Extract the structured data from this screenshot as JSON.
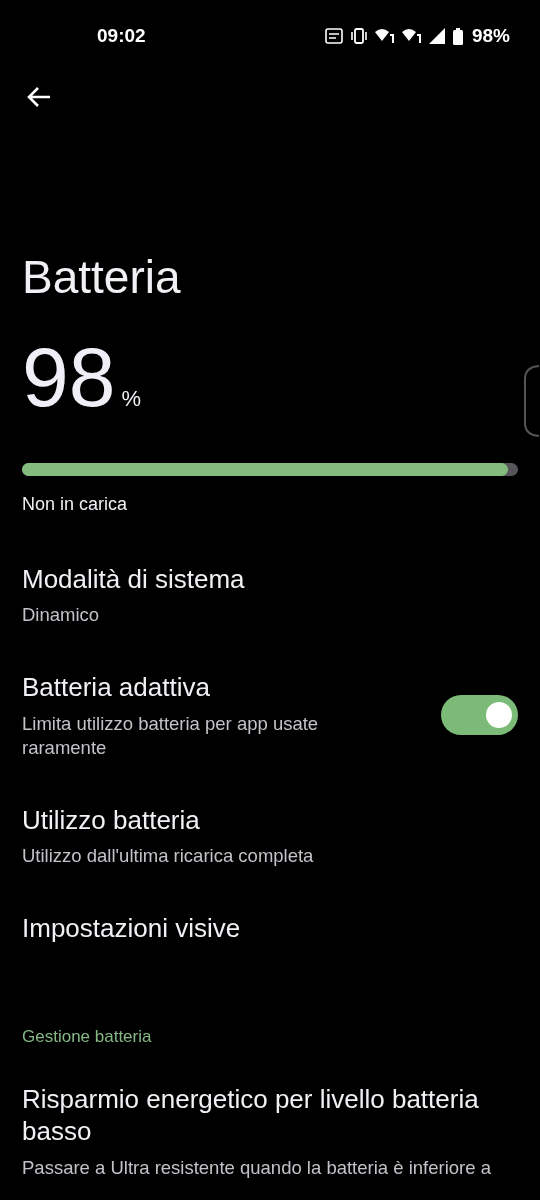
{
  "status_bar": {
    "time": "09:02",
    "battery": "98%"
  },
  "title": "Batteria",
  "battery": {
    "percent": "98",
    "unit": "%",
    "level": 0.98,
    "status": "Non in carica"
  },
  "items": [
    {
      "kind": "link",
      "title": "Modalità di sistema",
      "subtitle": "Dinamico"
    },
    {
      "kind": "toggle",
      "title": "Batteria adattiva",
      "subtitle": "Limita utilizzo batteria per app usate raramente",
      "on": true
    },
    {
      "kind": "link",
      "title": "Utilizzo batteria",
      "subtitle": "Utilizzo dall'ultima ricarica completa"
    },
    {
      "kind": "link",
      "title": "Impostazioni visive"
    }
  ],
  "section": {
    "header": "Gestione batteria",
    "items": [
      {
        "kind": "link",
        "title": "Risparmio energetico per livello batteria basso",
        "subtitle": "Passare a Ultra resistente quando la batteria è inferiore a"
      }
    ]
  }
}
